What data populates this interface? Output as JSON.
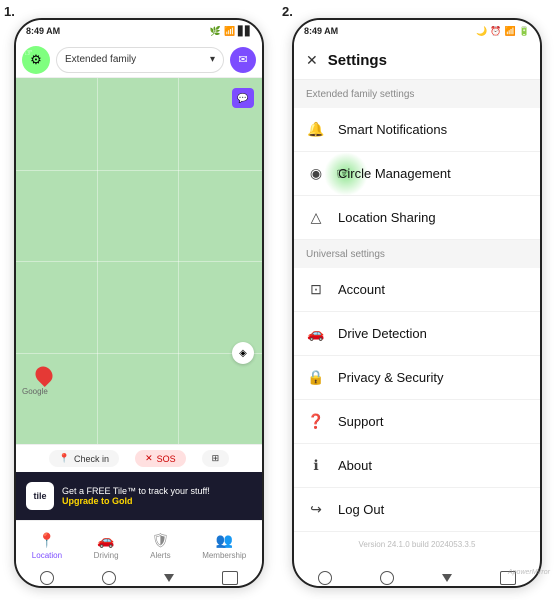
{
  "panel1": {
    "number": "1.",
    "status_bar": {
      "time": "8:49 AM",
      "battery_icon": "🔋",
      "signal": "📶",
      "wifi": "WiFi"
    },
    "header": {
      "family_dropdown": "Extended family",
      "dropdown_arrow": "▾"
    },
    "map": {
      "google_label": "Google"
    },
    "action_buttons": {
      "checkin": "Check in",
      "sos": "SOS"
    },
    "tile_banner": {
      "logo": "tile",
      "main_text": "Get a FREE Tile™ to track your stuff!",
      "upgrade_text": "Upgrade to Gold"
    },
    "nav": {
      "location": "Location",
      "driving": "Driving",
      "alerts": "Alerts",
      "membership": "Membership"
    }
  },
  "panel2": {
    "number": "2.",
    "status_bar": {
      "time": "8:49 AM"
    },
    "header": {
      "title": "Settings",
      "close": "✕"
    },
    "section_family": "Extended family settings",
    "items_family": [
      {
        "icon": "🔔",
        "label": "Smart Notifications"
      },
      {
        "icon": "◎",
        "label": "Circle Management"
      },
      {
        "icon": "📍",
        "label": "Location Sharing"
      }
    ],
    "section_universal": "Universal settings",
    "items_universal": [
      {
        "icon": "👤",
        "label": "Account"
      },
      {
        "icon": "🚗",
        "label": "Drive Detection"
      },
      {
        "icon": "🔒",
        "label": "Privacy & Security"
      },
      {
        "icon": "❓",
        "label": "Support"
      },
      {
        "icon": "ℹ",
        "label": "About"
      },
      {
        "icon": "↪",
        "label": "Log Out"
      }
    ],
    "version": "Version 24.1.0 build 2024053.3.5"
  }
}
